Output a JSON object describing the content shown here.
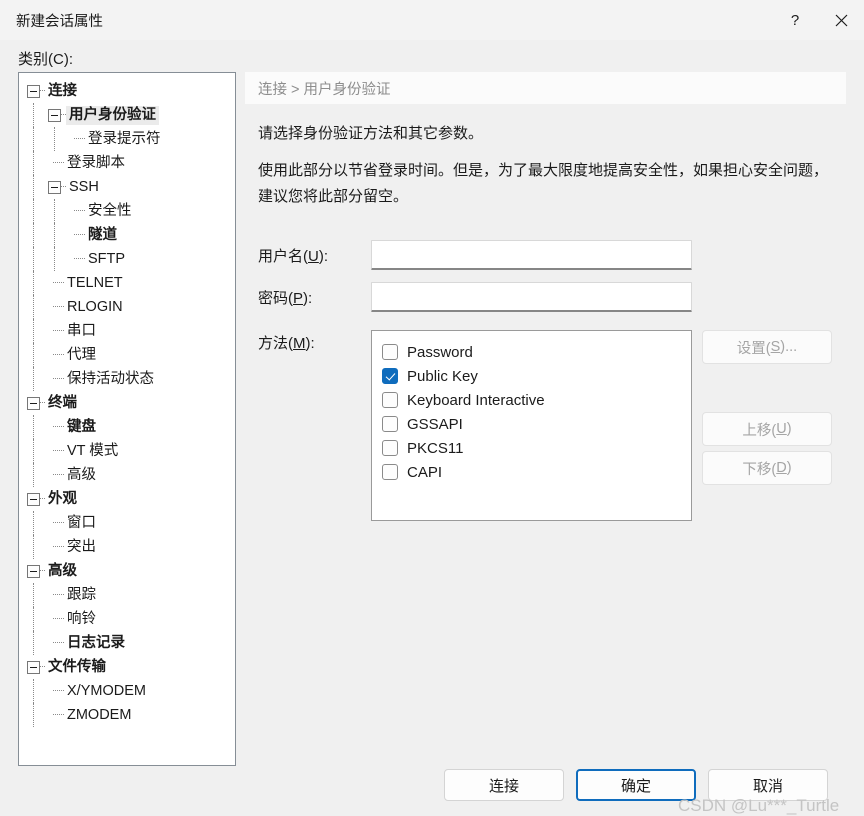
{
  "window": {
    "title": "新建会话属性",
    "help_icon": "question-mark-icon",
    "close_icon": "close-icon"
  },
  "sidebar": {
    "label": "类别(C):",
    "items": [
      {
        "label": "连接",
        "depth": 0,
        "bold": true,
        "expander": true,
        "selected": false
      },
      {
        "label": "用户身份验证",
        "depth": 1,
        "bold": true,
        "expander": true,
        "selected": true
      },
      {
        "label": "登录提示符",
        "depth": 2,
        "bold": false,
        "expander": false,
        "selected": false
      },
      {
        "label": "登录脚本",
        "depth": 1,
        "bold": false,
        "expander": false,
        "selected": false
      },
      {
        "label": "SSH",
        "depth": 1,
        "bold": false,
        "expander": true,
        "selected": false
      },
      {
        "label": "安全性",
        "depth": 2,
        "bold": false,
        "expander": false,
        "selected": false
      },
      {
        "label": "隧道",
        "depth": 2,
        "bold": true,
        "expander": false,
        "selected": false
      },
      {
        "label": "SFTP",
        "depth": 2,
        "bold": false,
        "expander": false,
        "selected": false
      },
      {
        "label": "TELNET",
        "depth": 1,
        "bold": false,
        "expander": false,
        "selected": false
      },
      {
        "label": "RLOGIN",
        "depth": 1,
        "bold": false,
        "expander": false,
        "selected": false
      },
      {
        "label": "串口",
        "depth": 1,
        "bold": false,
        "expander": false,
        "selected": false
      },
      {
        "label": "代理",
        "depth": 1,
        "bold": false,
        "expander": false,
        "selected": false
      },
      {
        "label": "保持活动状态",
        "depth": 1,
        "bold": false,
        "expander": false,
        "selected": false
      },
      {
        "label": "终端",
        "depth": 0,
        "bold": true,
        "expander": true,
        "selected": false
      },
      {
        "label": "键盘",
        "depth": 1,
        "bold": true,
        "expander": false,
        "selected": false
      },
      {
        "label": "VT 模式",
        "depth": 1,
        "bold": false,
        "expander": false,
        "selected": false
      },
      {
        "label": "高级",
        "depth": 1,
        "bold": false,
        "expander": false,
        "selected": false
      },
      {
        "label": "外观",
        "depth": 0,
        "bold": true,
        "expander": true,
        "selected": false
      },
      {
        "label": "窗口",
        "depth": 1,
        "bold": false,
        "expander": false,
        "selected": false
      },
      {
        "label": "突出",
        "depth": 1,
        "bold": false,
        "expander": false,
        "selected": false
      },
      {
        "label": "高级",
        "depth": 0,
        "bold": true,
        "expander": true,
        "selected": false
      },
      {
        "label": "跟踪",
        "depth": 1,
        "bold": false,
        "expander": false,
        "selected": false
      },
      {
        "label": "响铃",
        "depth": 1,
        "bold": false,
        "expander": false,
        "selected": false
      },
      {
        "label": "日志记录",
        "depth": 1,
        "bold": true,
        "expander": false,
        "selected": false
      },
      {
        "label": "文件传输",
        "depth": 0,
        "bold": true,
        "expander": true,
        "selected": false
      },
      {
        "label": "X/YMODEM",
        "depth": 1,
        "bold": false,
        "expander": false,
        "selected": false
      },
      {
        "label": "ZMODEM",
        "depth": 1,
        "bold": false,
        "expander": false,
        "selected": false
      }
    ]
  },
  "main": {
    "breadcrumb": "连接 > 用户身份验证",
    "description_1": "请选择身份验证方法和其它参数。",
    "description_2": "使用此部分以节省登录时间。但是，为了最大限度地提高安全性，如果担心安全问题，建议您将此部分留空。",
    "fields": [
      {
        "label": "用户名(U):",
        "accel": "U",
        "value": "",
        "placeholder": ""
      },
      {
        "label": "密码(P):",
        "accel": "P",
        "value": "",
        "placeholder": ""
      }
    ],
    "methods_label": "方法(M):",
    "methods": [
      {
        "label": "Password",
        "checked": false
      },
      {
        "label": "Public Key",
        "checked": true
      },
      {
        "label": "Keyboard Interactive",
        "checked": false
      },
      {
        "label": "GSSAPI",
        "checked": false
      },
      {
        "label": "PKCS11",
        "checked": false
      },
      {
        "label": "CAPI",
        "checked": false
      }
    ],
    "side_buttons": [
      {
        "label": "设置(S)...",
        "enabled": false
      },
      {
        "label": "上移(U)",
        "enabled": false
      },
      {
        "label": "下移(D)",
        "enabled": false
      }
    ]
  },
  "footer": {
    "buttons": [
      {
        "label": "连接",
        "focused": false
      },
      {
        "label": "确定",
        "focused": true
      },
      {
        "label": "取消",
        "focused": false
      }
    ]
  },
  "watermark": {
    "text": "CSDN @Lu***_Turtle"
  },
  "colors": {
    "accent": "#0f6cbd",
    "window_bg": "#f0f0f0",
    "panel_bg": "#ffffff",
    "disabled_text": "#a5a5a5",
    "breadcrumb_text": "#8d8d8d"
  }
}
